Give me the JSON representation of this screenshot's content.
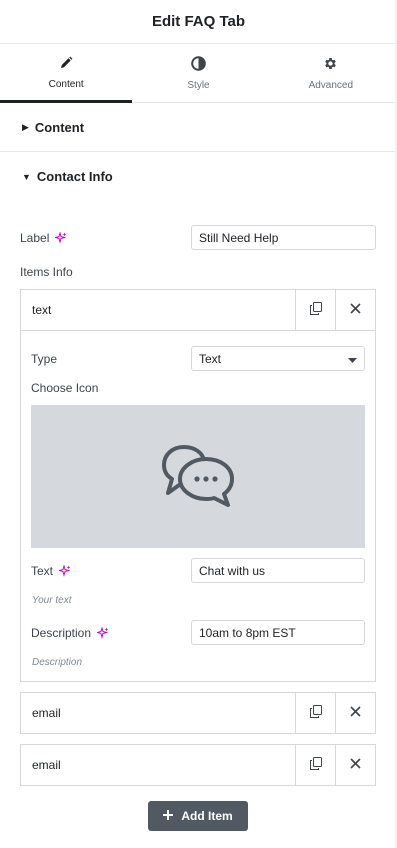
{
  "header": {
    "title": "Edit FAQ Tab"
  },
  "tabs": [
    {
      "label": "Content",
      "icon": "pencil-icon",
      "active": true
    },
    {
      "label": "Style",
      "icon": "contrast-icon",
      "active": false
    },
    {
      "label": "Advanced",
      "icon": "gear-icon",
      "active": false
    }
  ],
  "sections": {
    "content": {
      "title": "Content",
      "expanded": false
    },
    "contact_info": {
      "title": "Contact Info",
      "expanded": true
    }
  },
  "fields": {
    "label": {
      "label": "Label",
      "value": "Still Need Help"
    },
    "items_info": {
      "label": "Items Info"
    }
  },
  "items": [
    {
      "title": "text",
      "expanded": true,
      "type": {
        "label": "Type",
        "value": "Text"
      },
      "choose_icon": {
        "label": "Choose Icon",
        "icon": "chat-bubbles-icon"
      },
      "text": {
        "label": "Text",
        "value": "Chat with us",
        "hint": "Your text"
      },
      "description": {
        "label": "Description",
        "value": "10am to 8pm EST",
        "hint": "Description"
      }
    },
    {
      "title": "email",
      "expanded": false
    },
    {
      "title": "email",
      "expanded": false
    }
  ],
  "add_item": {
    "label": "Add Item"
  },
  "colors": {
    "accent_ai": "#c00bb9",
    "button_bg": "#515962",
    "border": "#d5d8dc"
  }
}
